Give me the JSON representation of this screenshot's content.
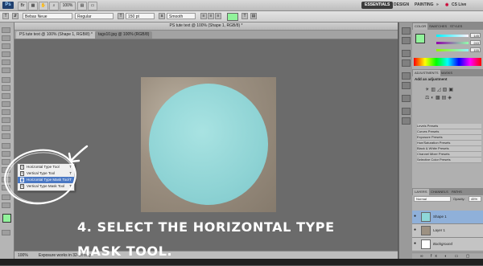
{
  "app_bar": {
    "logo": "Ps",
    "zoom": "100%",
    "workspaces": [
      "ESSENTIALS",
      "DESIGN",
      "PAINTING"
    ],
    "overflow": "»",
    "cs_live": "CS Live"
  },
  "options_bar": {
    "font_family": "Bebas Neue",
    "font_style": "Regular",
    "font_size": "150 pt",
    "anti_alias": "Smooth"
  },
  "document": {
    "window_title": "PS tute text @ 100% (Shape 1, RGB/8) *",
    "tabs": [
      {
        "label": "PS tute text @ 100% (Shape 1, RGB/8) *",
        "active": true
      },
      {
        "label": "tags10.jpg @ 100% (RGB/8)",
        "active": false
      }
    ],
    "zoom": "100%",
    "status": "Exposure works in 32-bit only"
  },
  "tool_flyout": {
    "items": [
      {
        "label": "Horizontal Type Tool",
        "shortcut": "T",
        "icon": "T",
        "selected": false
      },
      {
        "label": "Vertical Type Tool",
        "shortcut": "T",
        "icon": "T",
        "selected": false
      },
      {
        "label": "Horizontal Type Mask Tool",
        "shortcut": "T",
        "icon": "T",
        "selected": true
      },
      {
        "label": "Vertical Type Mask Tool",
        "shortcut": "T",
        "icon": "T",
        "selected": false
      }
    ]
  },
  "caption": "4. SELECT THE HORIZONTAL TYPE MASK TOOL.",
  "color_panel": {
    "tabs": [
      "COLOR",
      "SWATCHES",
      "STYLES"
    ],
    "r": "145",
    "g": "243",
    "b": "155",
    "fg_color": "#91f39b"
  },
  "adjustments_panel": {
    "tabs": [
      "ADJUSTMENTS",
      "MASKS"
    ],
    "heading": "Add an adjustment",
    "presets": [
      "Levels Presets",
      "Curves Presets",
      "Exposure Presets",
      "Hue/Saturation Presets",
      "Black & White Presets",
      "Channel Mixer Presets",
      "Selective Color Presets"
    ]
  },
  "layers_panel": {
    "tabs": [
      "LAYERS",
      "CHANNELS",
      "PATHS"
    ],
    "blend_mode": "Normal",
    "opacity_label": "Opacity:",
    "opacity": "45%",
    "layers": [
      {
        "name": "Shape 1",
        "selected": true
      },
      {
        "name": "Layer 1",
        "selected": false
      },
      {
        "name": "Background",
        "selected": false
      }
    ]
  },
  "colors": {
    "shape_fill": "#8ed7d9",
    "selection": "#4a78c4"
  }
}
